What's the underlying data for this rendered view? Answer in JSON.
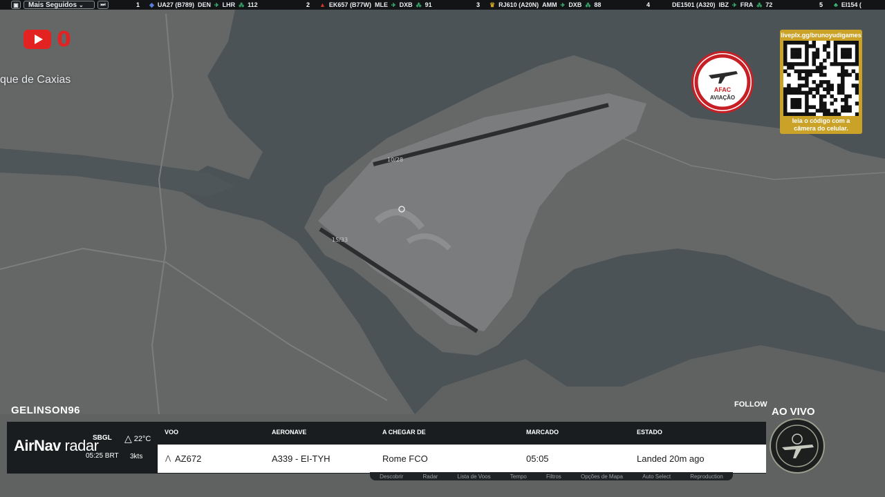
{
  "topbar": {
    "filter_label": "Mais Seguidos",
    "flights": [
      {
        "rank": "1",
        "code": "UA27 (B789)",
        "from": "DEN",
        "to": "LHR",
        "followers": "112"
      },
      {
        "rank": "2",
        "code": "EK657 (B77W)",
        "from": "MLE",
        "to": "DXB",
        "followers": "91"
      },
      {
        "rank": "3",
        "code": "RJ610 (A20N)",
        "from": "AMM",
        "to": "DXB",
        "followers": "88"
      },
      {
        "rank": "4",
        "code": "DE1501 (A320)",
        "from": "IBZ",
        "to": "FRA",
        "followers": "72"
      },
      {
        "rank": "5",
        "code": "EI154 (",
        "from": "",
        "to": "",
        "followers": ""
      }
    ]
  },
  "overlay": {
    "youtube_count": "0",
    "place_label": "que de Caxias",
    "afac_name": "AFAC",
    "afac_sub": "AVIAÇÃO",
    "qr_url": "liveplx.gg/brunoyudigames",
    "qr_caption_1": "leia o código com a",
    "qr_caption_2": "câmera do celular."
  },
  "stream": {
    "username": "GELINSON96",
    "follow_label": "FOLLOW",
    "live_label": "AO VIVO"
  },
  "panel": {
    "brand_1": "AirNav",
    "brand_2": "radar",
    "airport": "SBGL",
    "time": "05:25 BRT",
    "temp": "22°C",
    "wind": "3kts",
    "headers": {
      "flight": "VOO",
      "aircraft": "AERONAVE",
      "arriving": "A CHEGAR DE",
      "scheduled": "MARCADO",
      "status": "ESTADO"
    },
    "row": {
      "flight": "AZ672",
      "aircraft": "A339 - EI-TYH",
      "arriving": "Rome FCO",
      "scheduled": "05:05",
      "status": "Landed 20m ago"
    },
    "under_menu": [
      "Descobrir",
      "Radar",
      "Lista de Voos",
      "Tempo",
      "Filtros",
      "Opções de Mapa",
      "Auto Select",
      "Reproduction"
    ]
  },
  "map_labels": {
    "runway_a": "10/28",
    "runway_b": "15/33"
  },
  "colors": {
    "water": "#4b5357",
    "land": "#636665",
    "airport": "#7a7c7d",
    "accent_red": "#e32222",
    "qr_gold": "#c9a227",
    "status_green": "#3fc27a"
  }
}
